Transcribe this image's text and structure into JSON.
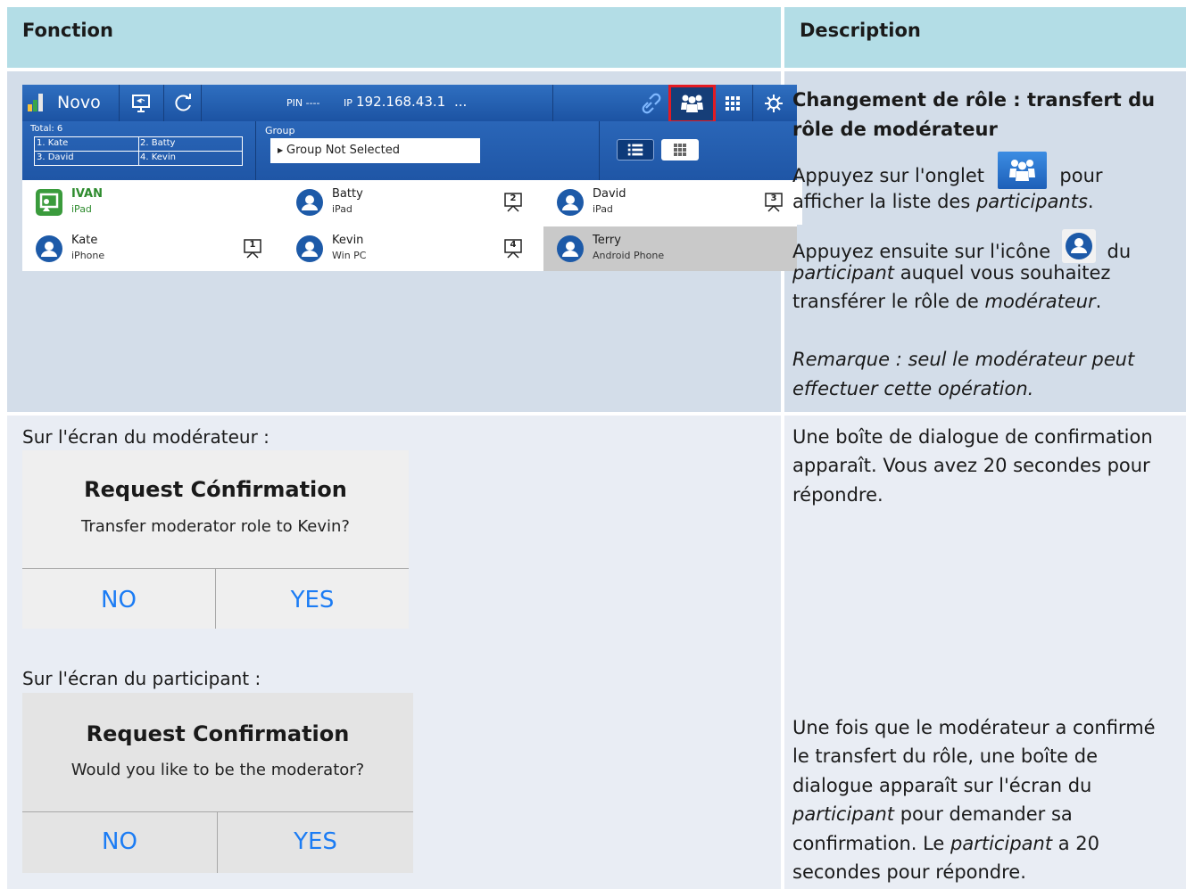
{
  "header": {
    "col1": "Fonction",
    "col2": "Description"
  },
  "novo": {
    "app_name": "Novo",
    "pin_label": "PIN ----",
    "ip_label": "IP",
    "ip_value": "192.168.43.1",
    "ellipsis": "...",
    "total_label": "Total: 6",
    "total_grid": [
      "1. Kate",
      "2. Batty",
      "3. David",
      "4. Kevin"
    ],
    "group_label": "Group",
    "group_value": "Group Not Selected",
    "participants": [
      {
        "name": "IVAN",
        "device": "iPad",
        "presenter": "",
        "highlight": "green"
      },
      {
        "name": "Batty",
        "device": "iPad",
        "presenter": "2"
      },
      {
        "name": "David",
        "device": "iPad",
        "presenter": "3"
      },
      {
        "name": "Kate",
        "device": "iPhone",
        "presenter": "1"
      },
      {
        "name": "Kevin",
        "device": "Win PC",
        "presenter": "4"
      },
      {
        "name": "Terry",
        "device": "Android Phone",
        "presenter": ""
      }
    ]
  },
  "row1": {
    "title": "Changement de rôle : transfert du rôle de modérateur",
    "line1_a": "Appuyez sur l'onglet",
    "line1_b": "pour",
    "line2_a": "afficher la liste des ",
    "line2_b": "participants",
    "line2_c": ".",
    "line3_a": "Appuyez ensuite sur l'icône",
    "line3_b": "du",
    "line4_a": "participant",
    "line4_b": " auquel vous souhaitez",
    "line5_a": "transférer le rôle de ",
    "line5_b": "modérateur",
    "line5_c": ".",
    "remark_1": "Remarque : seul le modérateur peut",
    "remark_2": "effectuer cette opération."
  },
  "row2": {
    "caption_mod": "Sur l'écran du modérateur :",
    "caption_part": "Sur l'écran du participant :",
    "dialog1": {
      "title": "Request Cónfirmation",
      "message": "Transfer moderator role to Kevin?",
      "no": "NO",
      "yes": "YES"
    },
    "dialog2": {
      "title": "Request Confirmation",
      "message": "Would you like to be the moderator?",
      "no": "NO",
      "yes": "YES"
    },
    "desc1": [
      "Une boîte de dialogue de confirmation",
      "apparaît. Vous avez 20 secondes pour",
      "répondre."
    ],
    "desc2_l1": "Une fois que le modérateur a confirmé",
    "desc2_l2": "le transfert du rôle, une boîte de",
    "desc2_l3": "dialogue apparaît sur l'écran du",
    "desc2_l4a": "participant",
    "desc2_l4b": " pour demander sa",
    "desc2_l5a": "confirmation. Le ",
    "desc2_l5b": "participant",
    "desc2_l5c": " a 20",
    "desc2_l6": "secondes pour répondre."
  }
}
